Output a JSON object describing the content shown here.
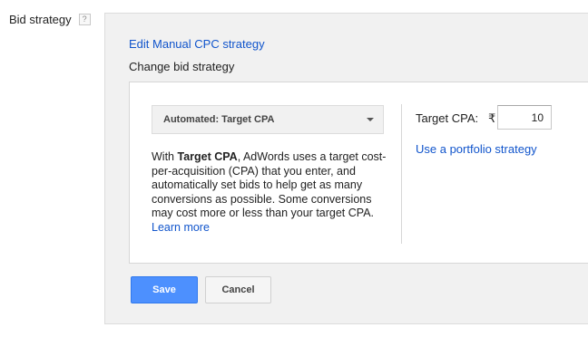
{
  "bid_strategy": {
    "label": "Bid strategy",
    "help_icon_text": "?"
  },
  "panel": {
    "edit_link": "Edit Manual CPC strategy",
    "change_label": "Change bid strategy",
    "dropdown": {
      "selected": "Automated: Target CPA"
    },
    "description": {
      "prefix": "With ",
      "strategy_name": "Target CPA",
      "body": ", AdWords uses a target cost-per-acquisition (CPA) that you enter, and automatically set bids to help get as many conversions as possible. Some conversions may cost more or less than your target CPA. ",
      "learn_more": "Learn more"
    },
    "target_cpa": {
      "label": "Target CPA:",
      "currency_symbol": "₹",
      "value": "10"
    },
    "portfolio_link": "Use a portfolio strategy",
    "buttons": {
      "save": "Save",
      "cancel": "Cancel"
    }
  },
  "colors": {
    "link": "#1155cc",
    "primary_button": "#4d90fe",
    "panel_background": "#f1f1f1"
  }
}
